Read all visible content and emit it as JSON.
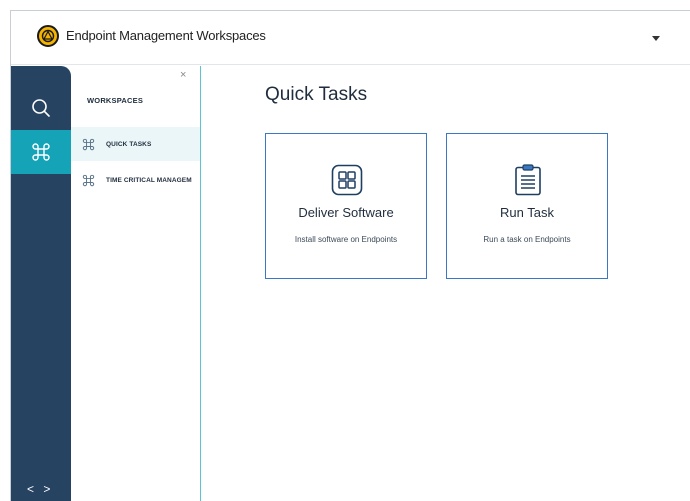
{
  "header": {
    "app_title": "Endpoint Management Workspaces",
    "logo_icon": "app-logo",
    "menu_icon": "caret-down-icon"
  },
  "rail": {
    "items": [
      {
        "icon": "search-icon",
        "active": false
      },
      {
        "icon": "command-icon",
        "active": true
      }
    ],
    "collapse_label": "< >"
  },
  "panel": {
    "close_label": "×",
    "title": "WORKSPACES",
    "items": [
      {
        "label": "QUICK TASKS",
        "icon": "command-icon",
        "active": true
      },
      {
        "label": "TIME CRITICAL MANAGEM",
        "icon": "command-icon",
        "active": false
      }
    ]
  },
  "main": {
    "title": "Quick Tasks",
    "cards": [
      {
        "title": "Deliver Software",
        "description": "Install software on Endpoints",
        "icon": "grid-icon"
      },
      {
        "title": "Run Task",
        "description": "Run a task on Endpoints",
        "icon": "clipboard-icon"
      }
    ]
  },
  "colors": {
    "rail": "#274362",
    "rail_active": "#15a3b8",
    "card_border": "#3b78c4",
    "panel_active": "#eaf6f8"
  }
}
